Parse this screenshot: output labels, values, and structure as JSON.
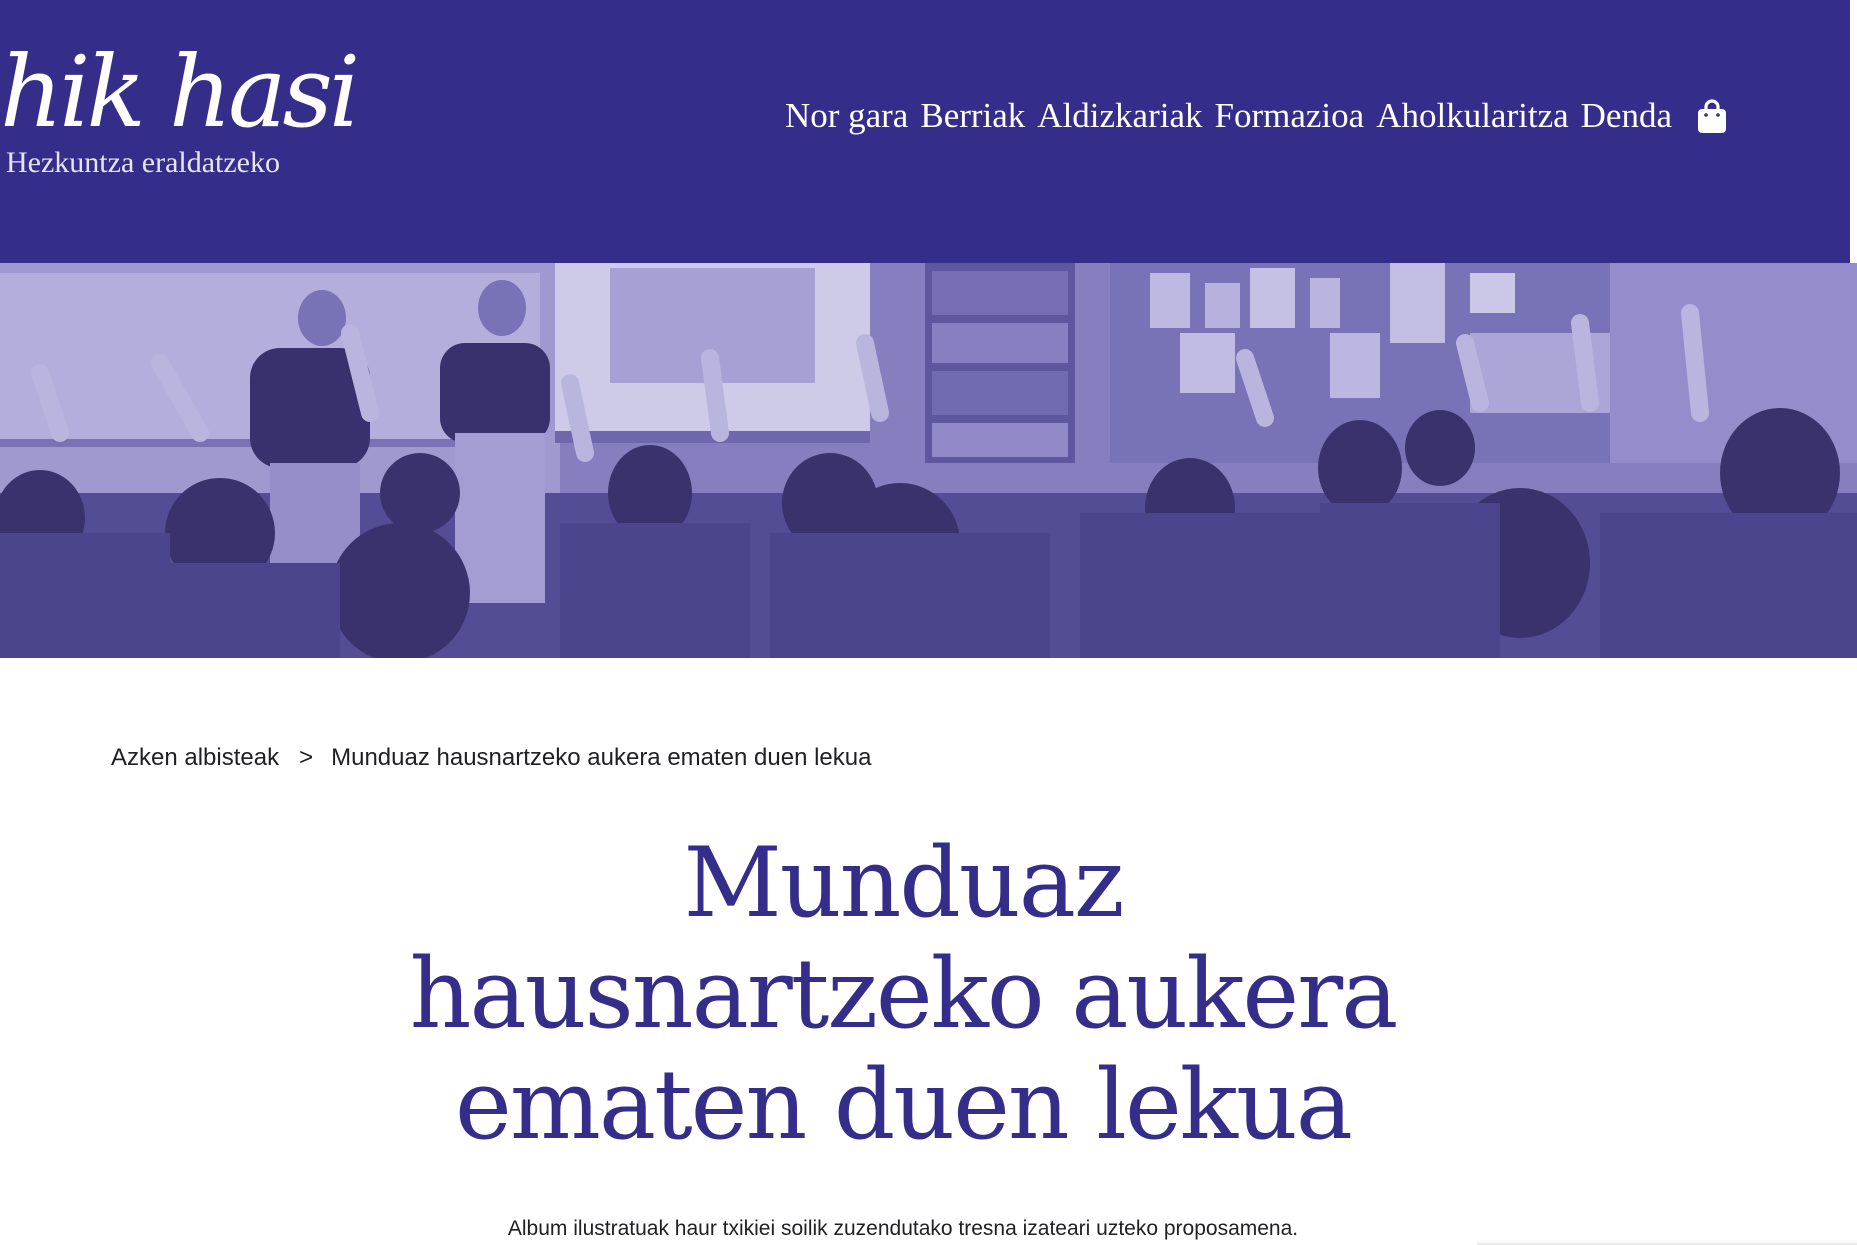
{
  "header": {
    "logo_text": "hik hasi",
    "tagline": "Hezkuntza eraldatzeko",
    "background_color": "#352d8a",
    "nav": [
      {
        "label": "Nor gara"
      },
      {
        "label": "Berriak"
      },
      {
        "label": "Aldizkariak"
      },
      {
        "label": "Formazioa"
      },
      {
        "label": "Aholkularitza"
      },
      {
        "label": "Denda"
      }
    ],
    "cart_icon": "shopping-bag-icon"
  },
  "hero": {
    "image": "classroom-photo",
    "tint_color": "#6f68b3"
  },
  "breadcrumb": {
    "parent": "Azken albisteak",
    "separator": ">",
    "current": "Munduaz hausnartzeko aukera ematen duen lekua"
  },
  "article": {
    "title": "Munduaz hausnartzeko aukera ematen duen lekua",
    "lead": "Album ilustratuak haur txikiei soilik zuzendutako tresna izateari uzteko proposamena.",
    "title_color": "#352d8a"
  }
}
